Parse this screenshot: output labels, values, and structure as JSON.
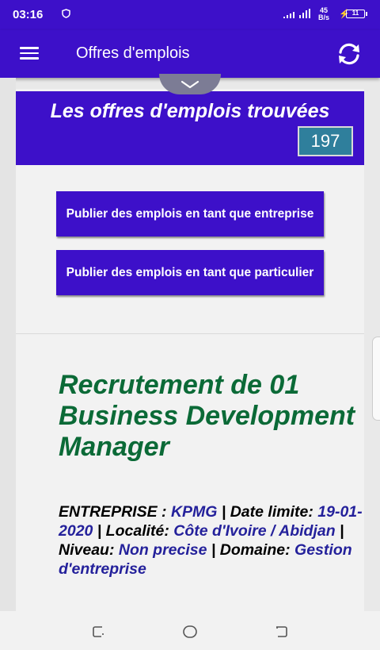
{
  "status_bar": {
    "time": "03:16",
    "network_speed_value": "45",
    "network_speed_unit": "B/s",
    "battery_level": "11"
  },
  "app_bar": {
    "title": "Offres d'emplois",
    "menu_icon": "hamburger-menu-icon",
    "refresh_icon": "refresh-icon"
  },
  "header": {
    "title": "Les offres d'emplois trouvées",
    "count": "197"
  },
  "actions": {
    "publish_company": "Publier des emplois en tant que entreprise",
    "publish_individual": "Publier des emplois en tant que particulier"
  },
  "job": {
    "title": "Recrutement de 01 Business Development Manager",
    "company_label": "ENTREPRISE : ",
    "company": "KPMG",
    "deadline_label": " | Date limite: ",
    "deadline": "19-01-2020",
    "location_label": " | Localité: ",
    "location": "Côte d'Ivoire / Abidjan",
    "level_label": " | Niveau: ",
    "level": "Non precise",
    "domain_label": " | Domaine: ",
    "domain": "Gestion d'entreprise"
  },
  "colors": {
    "primary": "#3d10c9",
    "job_title": "#0b6a37",
    "meta_value": "#24219b",
    "count_box": "#2f7f9c"
  }
}
